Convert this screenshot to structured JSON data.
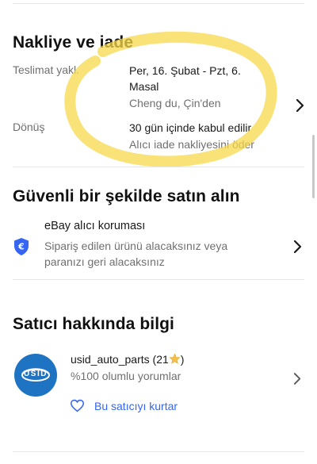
{
  "shipping": {
    "title": "Nakliye ve iade",
    "delivery_label": "Teslimat yakl.",
    "delivery_line1": "Per, 16. Şubat - Pzt, 6.",
    "delivery_line2": "Masal",
    "delivery_origin": "Cheng du, Çin'den",
    "returns_label": "Dönüş",
    "returns_value": "30 gün içinde kabul edilir",
    "returns_sub": "Alıcı iade nakliyesini öder"
  },
  "secure": {
    "title": "Güvenli bir şekilde satın alın",
    "protection_title": "eBay alıcı koruması",
    "protection_desc_line1": "Sipariş edilen ürünü alacaksınız veya",
    "protection_desc_line2": "paranızı geri alacaksınız"
  },
  "seller": {
    "title": "Satıcı hakkında bilgi",
    "name": "usid_auto_parts",
    "count": "(21",
    "count_close": ")",
    "rating": "%100 olumlu yorumlar",
    "save_label": "Bu satıcıyı kurtar",
    "logo_text": "USID"
  },
  "colors": {
    "highlight": "#f7d84a",
    "link": "#3665f3",
    "shield": "#3665f3"
  }
}
